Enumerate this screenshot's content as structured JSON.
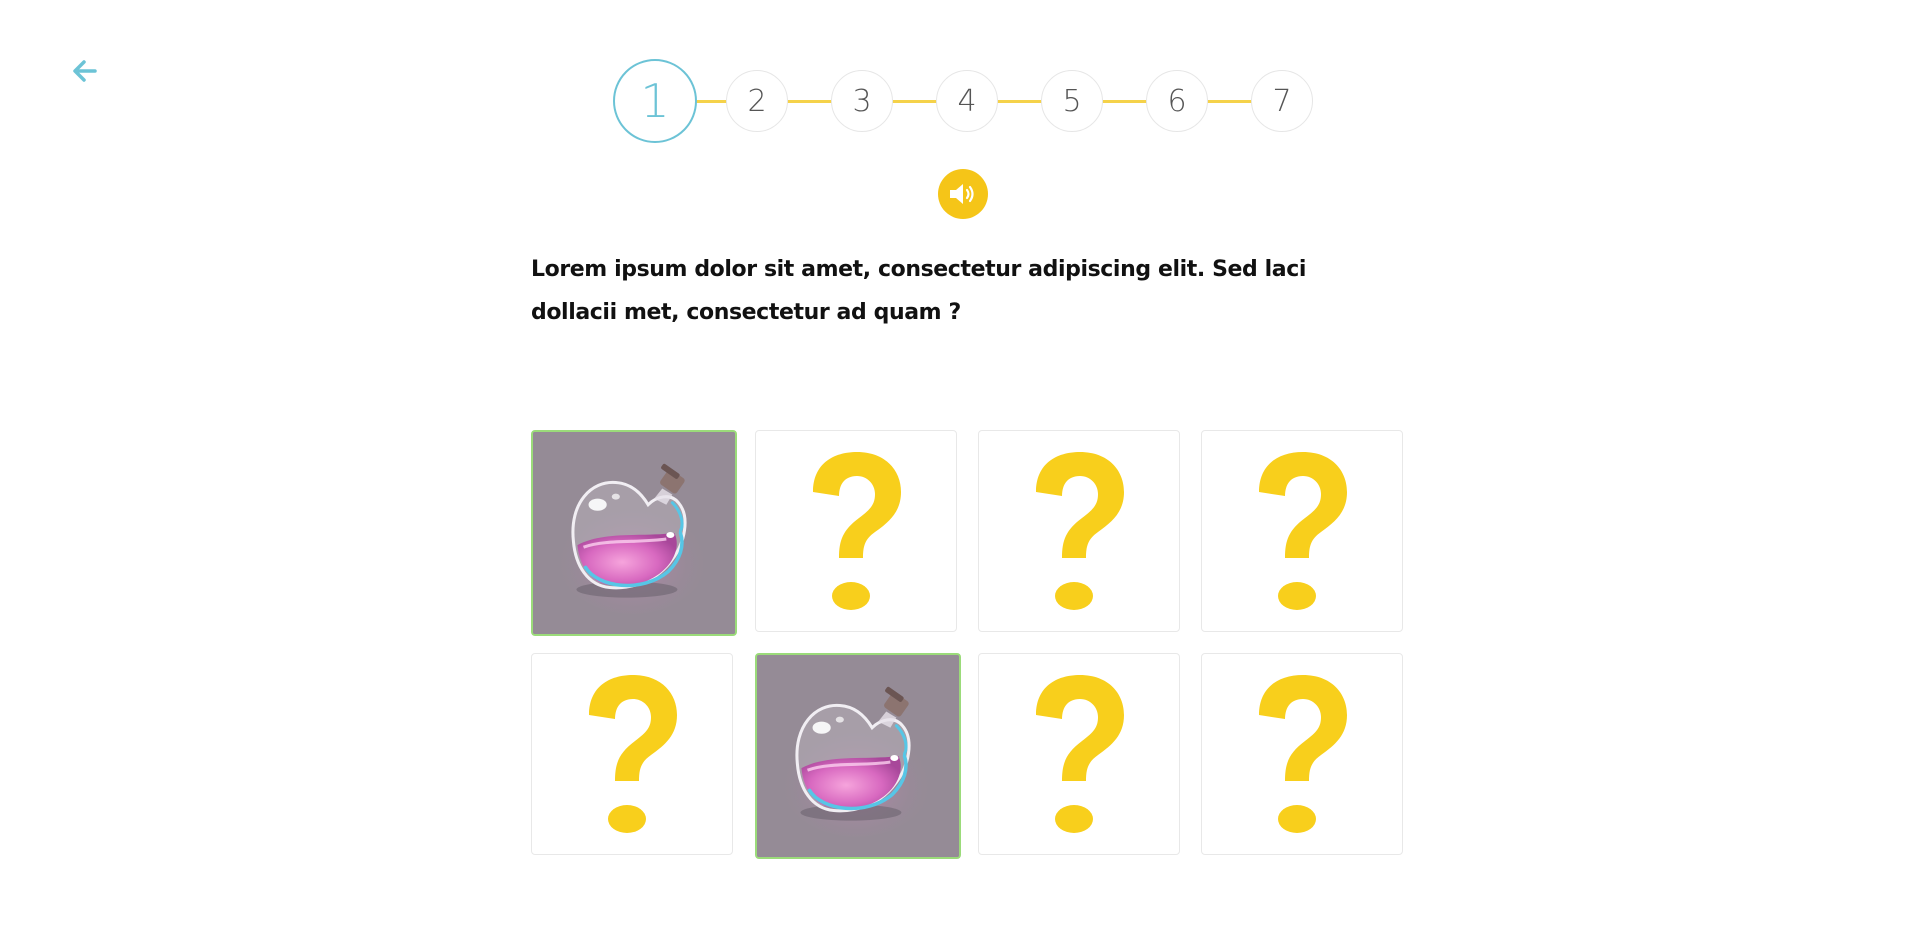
{
  "nav": {
    "back_icon": "arrow-left-icon",
    "accent_color": "#6cc3d6"
  },
  "stepper": {
    "current": 1,
    "steps": [
      "1",
      "2",
      "3",
      "4",
      "5",
      "6",
      "7"
    ],
    "line_color": "#f5d24a"
  },
  "audio": {
    "icon": "speaker-icon",
    "color": "#f5c518"
  },
  "question": {
    "text": "Lorem ipsum dolor sit amet, consectetur adipiscing elit. Sed laci dollacii met, consectetur ad quam ?"
  },
  "board": {
    "hidden_symbol": "?",
    "hidden_color": "#f8cf1c",
    "matched_border_color": "#9bdb7a",
    "cards": [
      {
        "state": "revealed",
        "image": "potion-bottle-image"
      },
      {
        "state": "hidden"
      },
      {
        "state": "hidden"
      },
      {
        "state": "hidden"
      },
      {
        "state": "hidden"
      },
      {
        "state": "revealed",
        "image": "potion-bottle-image"
      },
      {
        "state": "hidden"
      },
      {
        "state": "hidden"
      }
    ]
  }
}
